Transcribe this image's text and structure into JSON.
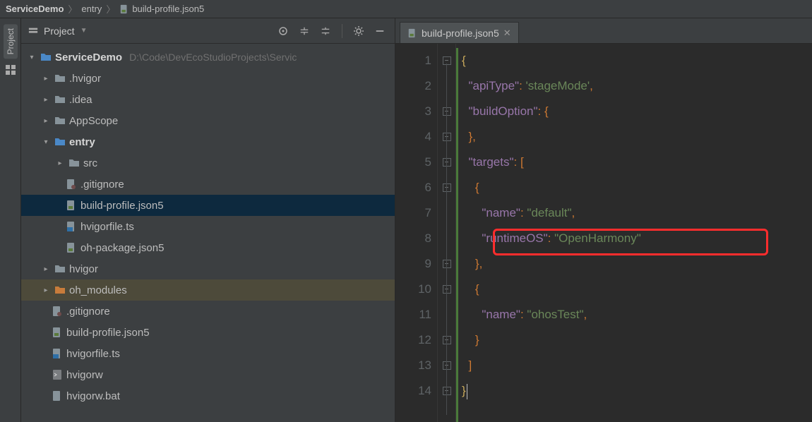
{
  "breadcrumbs": {
    "a": "ServiceDemo",
    "b": "entry",
    "c": "build-profile.json5"
  },
  "leftbar": {
    "project_tab": "Project"
  },
  "panel": {
    "title": "Project"
  },
  "tree": {
    "root": {
      "name": "ServiceDemo",
      "path": "D:\\Code\\DevEcoStudioProjects\\Servic"
    },
    "n_hvigor_dot": ".hvigor",
    "n_idea": ".idea",
    "n_appscope": "AppScope",
    "n_entry": "entry",
    "n_src": "src",
    "n_gitignore_a": ".gitignore",
    "n_buildprofile_a": "build-profile.json5",
    "n_hvigorfile_a": "hvigorfile.ts",
    "n_ohpkg": "oh-package.json5",
    "n_hvigor": "hvigor",
    "n_ohmodules": "oh_modules",
    "n_gitignore_b": ".gitignore",
    "n_buildprofile_b": "build-profile.json5",
    "n_hvigorfile_b": "hvigorfile.ts",
    "n_hvigorw": "hvigorw",
    "n_hvigorwbat": "hvigorw.bat"
  },
  "tab": {
    "title": "build-profile.json5"
  },
  "gutter": [
    "1",
    "2",
    "3",
    "4",
    "5",
    "6",
    "7",
    "8",
    "9",
    "10",
    "11",
    "12",
    "13",
    "14"
  ],
  "code": {
    "k_apiType": "\"apiType\"",
    "v_apiType": "'stageMode'",
    "k_buildOption": "\"buildOption\"",
    "k_targets": "\"targets\"",
    "k_name1": "\"name\"",
    "v_name1": "\"default\"",
    "k_runtimeOS": "\"runtimeOS\"",
    "v_runtimeOS": "\"OpenHarmony\"",
    "k_name2": "\"name\"",
    "v_name2": "\"ohosTest\""
  }
}
